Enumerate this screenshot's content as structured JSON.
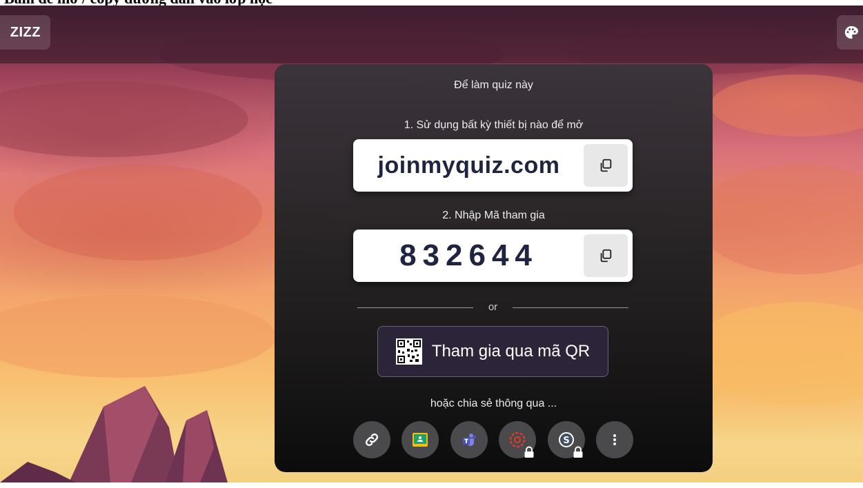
{
  "caption": {
    "text": "Bấm để mở / copy đường dẫn vào lớp học"
  },
  "header": {
    "logo_text": "ZIZZ",
    "theme_icon": "palette-icon"
  },
  "join_panel": {
    "heading": "Để làm quiz này",
    "step1_label": "1. Sử dụng bất kỳ thiết bị nào để mở",
    "join_url": "joinmyquiz.com",
    "step2_label": "2. Nhập Mã tham gia",
    "join_code": "832644",
    "divider_text": "or",
    "qr_button_label": "Tham gia qua mã QR",
    "share_label": "hoặc chia sẻ thông qua ...",
    "share_options": [
      {
        "icon": "link-icon",
        "locked": false
      },
      {
        "icon": "google-classroom-icon",
        "locked": false
      },
      {
        "icon": "microsoft-teams-icon",
        "locked": false
      },
      {
        "icon": "canvas-icon",
        "locked": true
      },
      {
        "icon": "schoology-icon",
        "locked": true
      },
      {
        "icon": "more-options-icon",
        "locked": false
      }
    ]
  },
  "colors": {
    "panel_bg": "#1e1e20",
    "code_text": "#1f2440",
    "qr_button_bg": "#2c2438"
  }
}
